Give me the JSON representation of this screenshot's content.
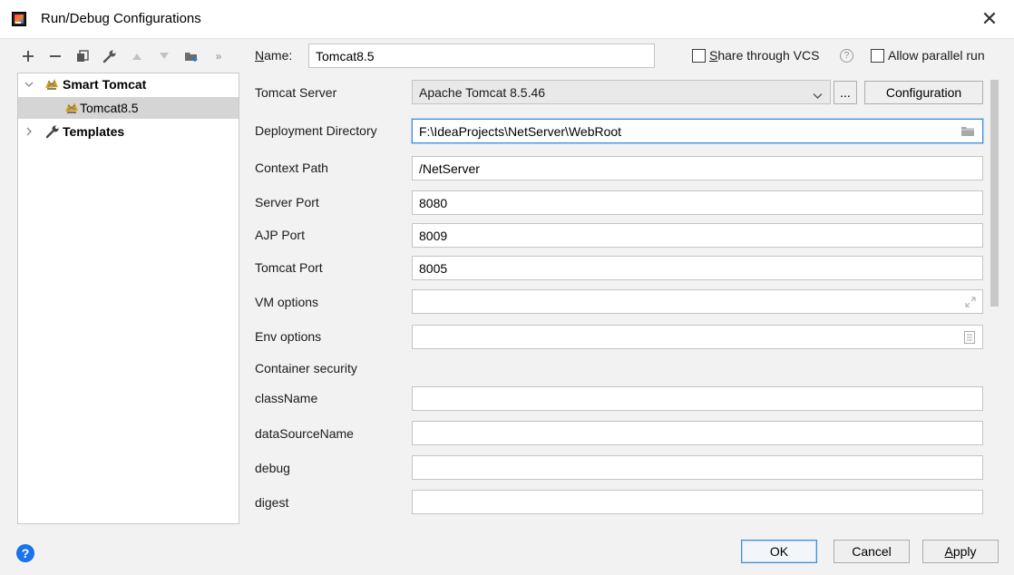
{
  "window": {
    "title": "Run/Debug Configurations"
  },
  "tree": {
    "groups": [
      {
        "label": "Smart Tomcat",
        "expanded": true,
        "children": [
          "Tomcat8.5"
        ]
      },
      {
        "label": "Templates",
        "expanded": false
      }
    ]
  },
  "header": {
    "name_label": "Name:",
    "name_value": "Tomcat8.5",
    "share_label": "Share through VCS",
    "allow_parallel_label": "Allow parallel run"
  },
  "form": {
    "tomcat_server_label": "Tomcat Server",
    "tomcat_server_value": "Apache Tomcat 8.5.46",
    "ellipsis_label": "...",
    "configuration_label": "Configuration",
    "deployment_dir_label": "Deployment Directory",
    "deployment_dir_value": "F:\\IdeaProjects\\NetServer\\WebRoot",
    "context_path_label": "Context Path",
    "context_path_value": "/NetServer",
    "server_port_label": "Server Port",
    "server_port_value": "8080",
    "ajp_port_label": "AJP Port",
    "ajp_port_value": "8009",
    "tomcat_port_label": "Tomcat Port",
    "tomcat_port_value": "8005",
    "vm_options_label": "VM options",
    "vm_options_value": "",
    "env_options_label": "Env options",
    "env_options_value": "",
    "container_security_label": "Container security",
    "classname_label": "className",
    "classname_value": "",
    "datasource_label": "dataSourceName",
    "datasource_value": "",
    "debug_label": "debug",
    "debug_value": "",
    "digest_label": "digest",
    "digest_value": ""
  },
  "footer": {
    "ok_label": "OK",
    "cancel_label": "Cancel",
    "apply_label": "Apply"
  },
  "colors": {
    "accent": "#3d8fd6",
    "help_badge": "#1a73e8",
    "selection": "#d5d5d5"
  }
}
